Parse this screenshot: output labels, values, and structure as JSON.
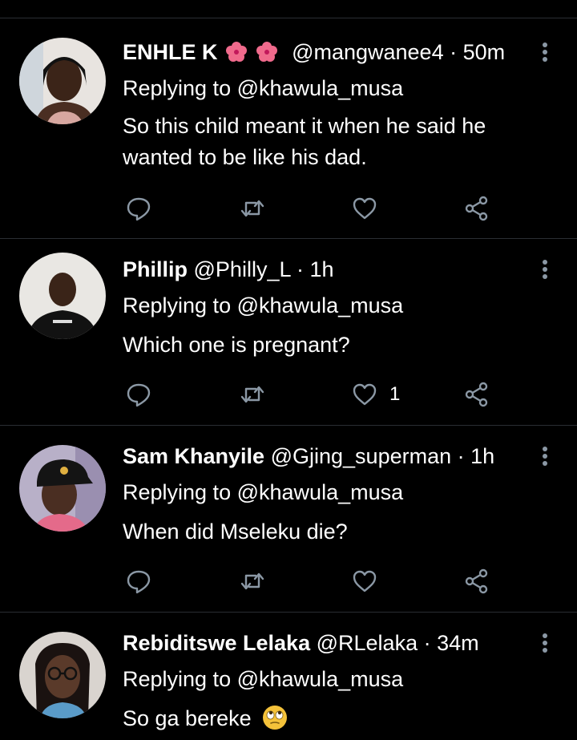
{
  "tweets": [
    {
      "name": "ENHLE K",
      "handle": "@mangwanee4",
      "separator": "·",
      "time": "50m",
      "replying_label": "Replying to",
      "replying_to": "@khawula_musa",
      "text": "So this child meant it when he said he wanted to be like his dad.",
      "like_count": ""
    },
    {
      "name": "Phillip",
      "handle": "@Philly_L",
      "separator": "·",
      "time": "1h",
      "replying_label": "Replying to",
      "replying_to": "@khawula_musa",
      "text": "Which one is pregnant?",
      "like_count": "1"
    },
    {
      "name": "Sam Khanyile",
      "handle": "@Gjing_superman",
      "separator": "·",
      "time": "1h",
      "replying_label": "Replying to",
      "replying_to": "@khawula_musa",
      "text": "When did Mseleku die?",
      "like_count": ""
    },
    {
      "name": "Rebiditswe Lelaka",
      "handle": "@RLelaka",
      "separator": "·",
      "time": "34m",
      "replying_label": "Replying to",
      "replying_to": "@khawula_musa",
      "text": "So ga bereke",
      "like_count": ""
    }
  ],
  "colors": {
    "background": "#000000",
    "text": "#ffffff",
    "icon": "#8b98a5",
    "divider": "#2a2e33",
    "flower": "#f06a8c"
  },
  "icons": [
    "reply-icon",
    "retweet-icon",
    "like-icon",
    "share-icon",
    "more-icon",
    "hibiscus-emoji",
    "rolling-eyes-emoji"
  ]
}
